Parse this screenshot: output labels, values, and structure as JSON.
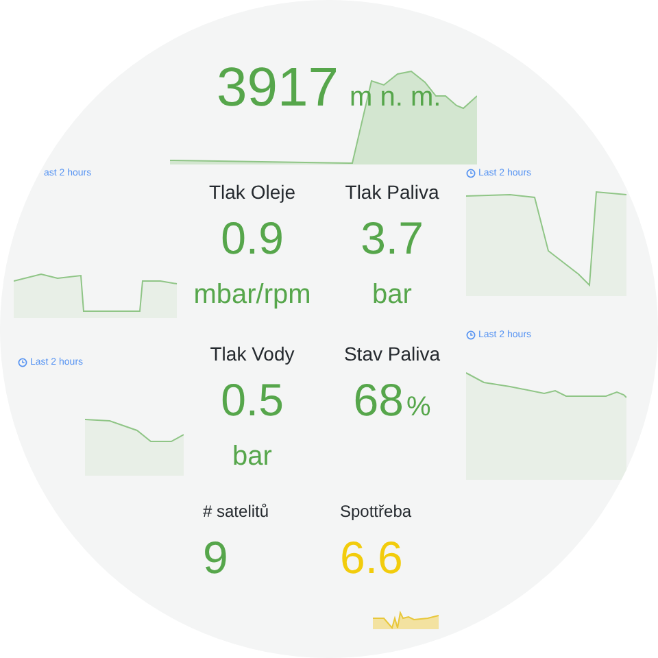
{
  "top_panel": {
    "value": "3917",
    "unit": "m n. m.",
    "color": "#56a64b"
  },
  "rows": [
    {
      "panels": [
        {
          "kind": "graph",
          "time_range": "ast 2 hours",
          "clock_icon": false
        },
        {
          "kind": "stat",
          "title": "Tlak Oleje",
          "value": "0.9",
          "unit": "mbar/rpm",
          "color": "#56a64b"
        },
        {
          "kind": "stat",
          "title": "Tlak Paliva",
          "value": "3.7",
          "unit": "bar",
          "color": "#56a64b"
        },
        {
          "kind": "graph",
          "time_range": "Last 2 hours",
          "clock_icon": true
        }
      ]
    },
    {
      "panels": [
        {
          "kind": "graph",
          "time_range": "Last 2 hours",
          "clock_icon": true
        },
        {
          "kind": "stat",
          "title": "Tlak Vody",
          "value": "0.5",
          "unit": "bar",
          "color": "#56a64b"
        },
        {
          "kind": "stat_inline_unit",
          "title": "Stav Paliva",
          "value": "68",
          "unit": "%",
          "color": "#56a64b"
        },
        {
          "kind": "graph",
          "time_range": "Last 2 hours",
          "clock_icon": true
        }
      ]
    },
    {
      "panels": [
        {
          "kind": "stat_compact",
          "title": "# satelitů",
          "value": "9",
          "color": "#56a64b",
          "sparkline": false
        },
        {
          "kind": "stat_compact",
          "title": "Spottřeba",
          "value": "6.6",
          "color": "#f2cc0c",
          "sparkline": true
        }
      ]
    }
  ]
}
